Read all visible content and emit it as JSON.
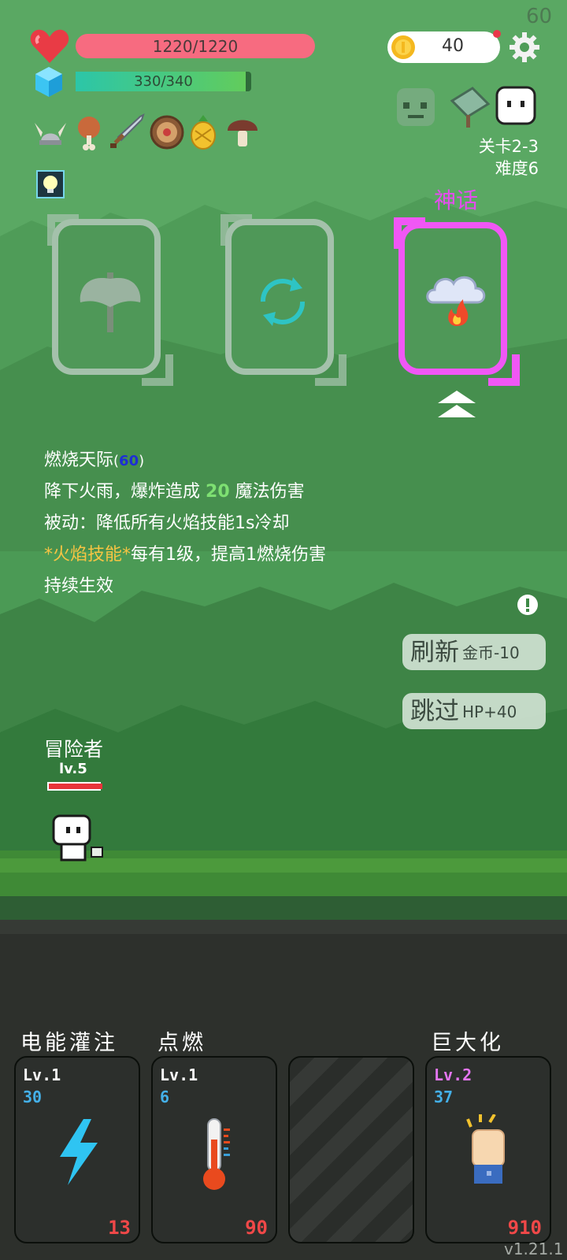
{
  "fps": "60",
  "player": {
    "hp": {
      "text": "1220/1220",
      "current": 1220,
      "max": 1220
    },
    "mp": {
      "text": "330/340",
      "current": 330,
      "max": 340
    },
    "name": "冒险者",
    "level": "lv.5",
    "hp_level": 1.0
  },
  "coins": {
    "value": "40",
    "icon": "gold-coin-icon"
  },
  "settings_icon": "gear-icon",
  "enemies": [
    "zombie-head-icon",
    "sign-board-icon",
    "ghost-icon"
  ],
  "stage": {
    "level": "关卡2-3",
    "difficulty": "难度6"
  },
  "items": [
    "viking-helmet-icon",
    "meat-drumstick-icon",
    "sword-icon",
    "round-shield-icon",
    "pineapple-icon",
    "mushroom-icon"
  ],
  "buff_icon": "lightbulb-icon",
  "choices": [
    {
      "icon": "axe-icon",
      "state": "locked"
    },
    {
      "icon": "refresh-cycle-icon",
      "state": "locked"
    },
    {
      "icon": "fire-cloud-icon",
      "rarity": "神话",
      "state": "selected"
    }
  ],
  "selected_skill": {
    "name": "燃烧天际",
    "cost_open": "(",
    "cost": "60",
    "cost_close": ")",
    "line1_a": "降下火雨，爆炸造成",
    "line1_value": "20",
    "line1_b": "魔法伤害",
    "line2": "被动：降低所有火焰技能1s冷却",
    "line3_tag": "*火焰技能*",
    "line3_rest": "每有1级，提高1燃烧伤害",
    "line4": "持续生效"
  },
  "info_icon": "exclamation-icon",
  "upgrade_icon": "double-chevron-up-icon",
  "buttons": {
    "refresh": {
      "label": "刷新",
      "cost": "金币-10"
    },
    "skip": {
      "label": "跳过",
      "bonus": "HP+40"
    }
  },
  "skill_cards": [
    {
      "name": "电能灌注",
      "level": "Lv.1",
      "value": "30",
      "count": "13",
      "icon": "lightning-bolt-icon",
      "level_color": "#ffffff"
    },
    {
      "name": "点燃",
      "level": "Lv.1",
      "value": "6",
      "count": "90",
      "icon": "thermometer-icon",
      "level_color": "#ffffff"
    },
    {
      "name": "",
      "state": "empty"
    },
    {
      "name": "巨大化",
      "level": "Lv.2",
      "value": "37",
      "count": "910",
      "icon": "raised-fist-icon",
      "level_color": "#e476f2"
    }
  ],
  "version": "v1.21.1",
  "colors": {
    "rarity_mythic": "#e64bf0",
    "hp": "#f76b80",
    "mp_start": "#2cc6a8",
    "mp_end": "#62cc5c",
    "damage_value": "#7ee072",
    "fire_tag": "#f6c443",
    "cost_value": "#1d2fd4"
  }
}
